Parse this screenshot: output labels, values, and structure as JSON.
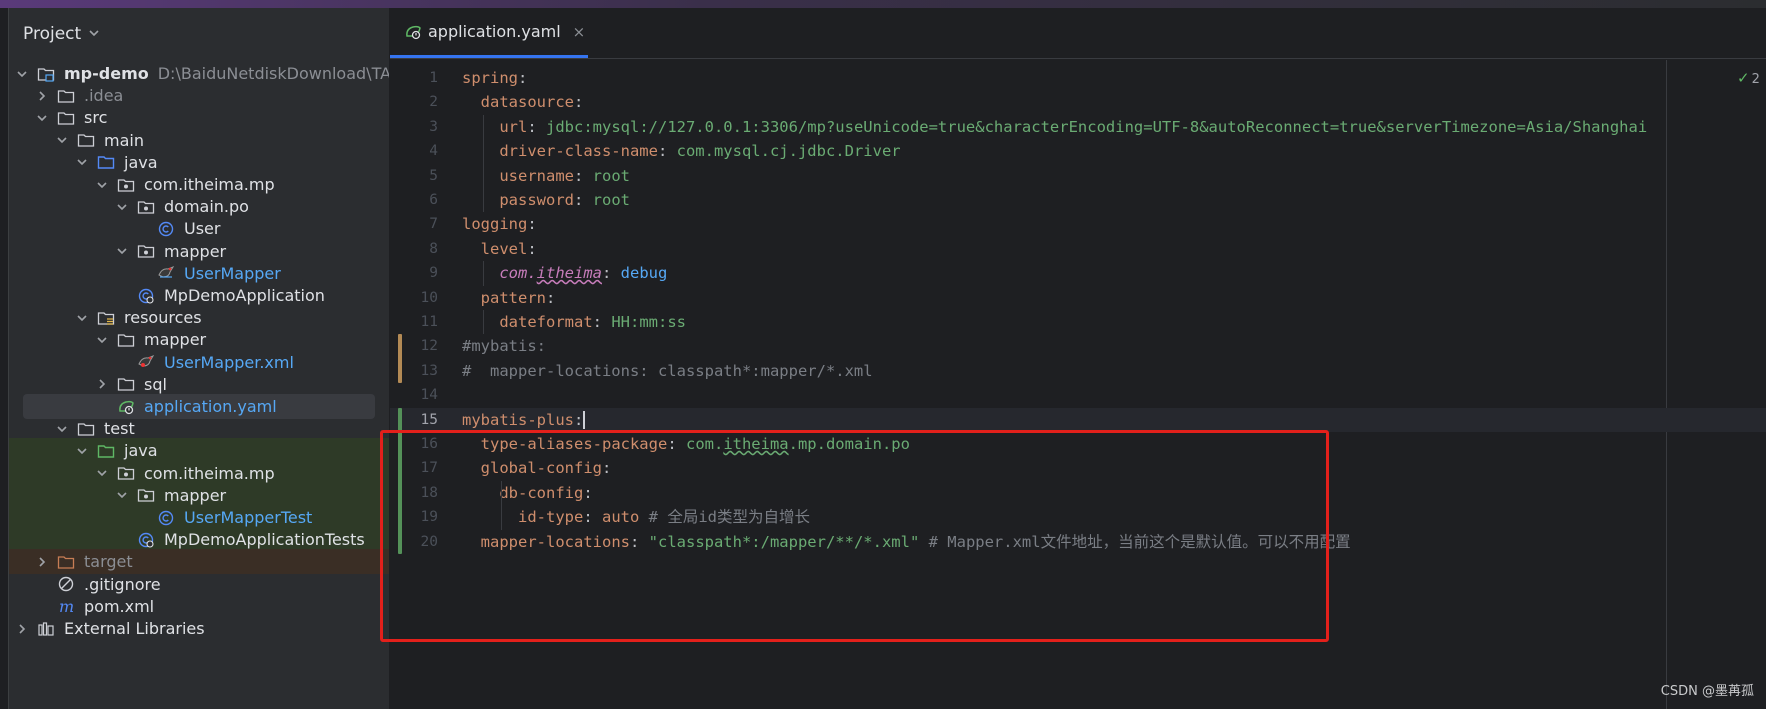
{
  "project_panel": {
    "title": "Project",
    "root_name": "mp-demo",
    "root_path": "D:\\BaiduNetdiskDownload\\TAG",
    "tree": [
      {
        "label": "mp-demo",
        "depth": 0,
        "arrow": "down",
        "icon": "module-folder-icon",
        "style": "bold"
      },
      {
        "label": ".idea",
        "depth": 1,
        "arrow": "right",
        "icon": "folder-icon",
        "style": "dim"
      },
      {
        "label": "src",
        "depth": 1,
        "arrow": "down",
        "icon": "folder-icon"
      },
      {
        "label": "main",
        "depth": 2,
        "arrow": "down",
        "icon": "folder-icon"
      },
      {
        "label": "java",
        "depth": 3,
        "arrow": "down",
        "icon": "source-folder-icon"
      },
      {
        "label": "com.itheima.mp",
        "depth": 4,
        "arrow": "down",
        "icon": "package-icon"
      },
      {
        "label": "domain.po",
        "depth": 5,
        "arrow": "down",
        "icon": "package-icon"
      },
      {
        "label": "User",
        "depth": 6,
        "arrow": "none",
        "icon": "class-icon"
      },
      {
        "label": "mapper",
        "depth": 5,
        "arrow": "down",
        "icon": "package-icon"
      },
      {
        "label": "UserMapper",
        "depth": 6,
        "arrow": "none",
        "icon": "mybatis-bird-icon",
        "style": "blue"
      },
      {
        "label": "MpDemoApplication",
        "depth": 5,
        "arrow": "none",
        "icon": "spring-class-icon"
      },
      {
        "label": "resources",
        "depth": 3,
        "arrow": "down",
        "icon": "resources-folder-icon"
      },
      {
        "label": "mapper",
        "depth": 4,
        "arrow": "down",
        "icon": "folder-icon"
      },
      {
        "label": "UserMapper.xml",
        "depth": 5,
        "arrow": "none",
        "icon": "mybatis-xml-icon",
        "style": "blue"
      },
      {
        "label": "sql",
        "depth": 4,
        "arrow": "right",
        "icon": "folder-icon"
      },
      {
        "label": "application.yaml",
        "depth": 4,
        "arrow": "none",
        "icon": "spring-yaml-icon",
        "style": "blue",
        "selected": true
      },
      {
        "label": "test",
        "depth": 2,
        "arrow": "down",
        "icon": "folder-icon"
      },
      {
        "label": "java",
        "depth": 3,
        "arrow": "down",
        "icon": "test-folder-icon",
        "bg": "green"
      },
      {
        "label": "com.itheima.mp",
        "depth": 4,
        "arrow": "down",
        "icon": "package-icon",
        "bg": "green"
      },
      {
        "label": "mapper",
        "depth": 5,
        "arrow": "down",
        "icon": "package-icon",
        "bg": "green"
      },
      {
        "label": "UserMapperTest",
        "depth": 6,
        "arrow": "none",
        "icon": "class-icon",
        "style": "blue",
        "bg": "green"
      },
      {
        "label": "MpDemoApplicationTests",
        "depth": 5,
        "arrow": "none",
        "icon": "spring-class-icon",
        "bg": "green"
      },
      {
        "label": "target",
        "depth": 1,
        "arrow": "right",
        "icon": "excluded-folder-icon",
        "style": "dim",
        "bg": "brown"
      },
      {
        "label": ".gitignore",
        "depth": 1,
        "arrow": "none",
        "icon": "ignore-file-icon"
      },
      {
        "label": "pom.xml",
        "depth": 1,
        "arrow": "none",
        "icon": "maven-icon"
      },
      {
        "label": "External Libraries",
        "depth": 0,
        "arrow": "right",
        "icon": "library-icon"
      }
    ]
  },
  "editor": {
    "tab_label": "application.yaml",
    "tab_close": "×",
    "inspection_count": "2",
    "current_line": 15,
    "lines": [
      {
        "n": "1",
        "tokens": [
          [
            "k",
            "spring"
          ],
          [
            "p",
            ":"
          ]
        ]
      },
      {
        "n": "2",
        "tokens": [
          [
            "p",
            "  "
          ],
          [
            "k",
            "datasource"
          ],
          [
            "p",
            ":"
          ]
        ]
      },
      {
        "n": "3",
        "tokens": [
          [
            "p",
            "    "
          ],
          [
            "k",
            "url"
          ],
          [
            "p",
            ": "
          ],
          [
            "v",
            "jdbc:mysql://127.0.0.1:3306/mp?useUnicode=true&characterEncoding=UTF-8&autoReconnect=true&serverTimezone=Asia/Shanghai"
          ]
        ]
      },
      {
        "n": "4",
        "tokens": [
          [
            "p",
            "    "
          ],
          [
            "k",
            "driver-class-name"
          ],
          [
            "p",
            ": "
          ],
          [
            "v",
            "com.mysql.cj.jdbc.Driver"
          ]
        ]
      },
      {
        "n": "5",
        "tokens": [
          [
            "p",
            "    "
          ],
          [
            "k",
            "username"
          ],
          [
            "p",
            ": "
          ],
          [
            "v",
            "root"
          ]
        ]
      },
      {
        "n": "6",
        "tokens": [
          [
            "p",
            "    "
          ],
          [
            "k",
            "password"
          ],
          [
            "p",
            ": "
          ],
          [
            "v",
            "root"
          ]
        ]
      },
      {
        "n": "7",
        "tokens": [
          [
            "k",
            "logging"
          ],
          [
            "p",
            ":"
          ]
        ]
      },
      {
        "n": "8",
        "tokens": [
          [
            "p",
            "  "
          ],
          [
            "k",
            "level"
          ],
          [
            "p",
            ":"
          ]
        ]
      },
      {
        "n": "9",
        "tokens": [
          [
            "p",
            "    "
          ],
          [
            "ki",
            "com."
          ],
          [
            "ki-u",
            "itheima"
          ],
          [
            "p",
            ": "
          ],
          [
            "vb",
            "debug"
          ]
        ]
      },
      {
        "n": "10",
        "tokens": [
          [
            "p",
            "  "
          ],
          [
            "k",
            "pattern"
          ],
          [
            "p",
            ":"
          ]
        ]
      },
      {
        "n": "11",
        "tokens": [
          [
            "p",
            "    "
          ],
          [
            "k",
            "dateformat"
          ],
          [
            "p",
            ": "
          ],
          [
            "v",
            "HH:mm:ss"
          ]
        ]
      },
      {
        "n": "12",
        "tokens": [
          [
            "c",
            "#mybatis:"
          ]
        ]
      },
      {
        "n": "13",
        "tokens": [
          [
            "c",
            "#  mapper-locations: classpath*:mapper/*.xml"
          ]
        ]
      },
      {
        "n": "14",
        "tokens": []
      },
      {
        "n": "15",
        "tokens": [
          [
            "k",
            "mybatis-plus"
          ],
          [
            "p",
            ":"
          ],
          [
            "caret",
            ""
          ]
        ]
      },
      {
        "n": "16",
        "tokens": [
          [
            "p",
            "  "
          ],
          [
            "k",
            "type-aliases-package"
          ],
          [
            "p",
            ": "
          ],
          [
            "v",
            "com."
          ],
          [
            "v-u",
            "itheima"
          ],
          [
            "v",
            ".mp.domain.po"
          ]
        ]
      },
      {
        "n": "17",
        "tokens": [
          [
            "p",
            "  "
          ],
          [
            "k",
            "global-config"
          ],
          [
            "p",
            ":"
          ]
        ]
      },
      {
        "n": "18",
        "tokens": [
          [
            "p",
            "    "
          ],
          [
            "k",
            "db-config"
          ],
          [
            "p",
            ":"
          ]
        ]
      },
      {
        "n": "19",
        "tokens": [
          [
            "p",
            "      "
          ],
          [
            "k",
            "id-type"
          ],
          [
            "p",
            ": "
          ],
          [
            "k",
            "auto"
          ],
          [
            "c",
            " # 全局id类型为自增长"
          ]
        ]
      },
      {
        "n": "20",
        "tokens": [
          [
            "p",
            "  "
          ],
          [
            "k",
            "mapper-locations"
          ],
          [
            "p",
            ": "
          ],
          [
            "v",
            "\"classpath*:/mapper/**/*.xml\""
          ],
          [
            "c",
            " # Mapper.xml文件地址，当前这个是默认值。可以不用配置"
          ]
        ]
      }
    ]
  },
  "colors": {
    "accent": "#3574f0",
    "highlight_box": "#e3201b",
    "test_bg": "#2e3a27"
  },
  "watermark": "CSDN @墨苒孤"
}
